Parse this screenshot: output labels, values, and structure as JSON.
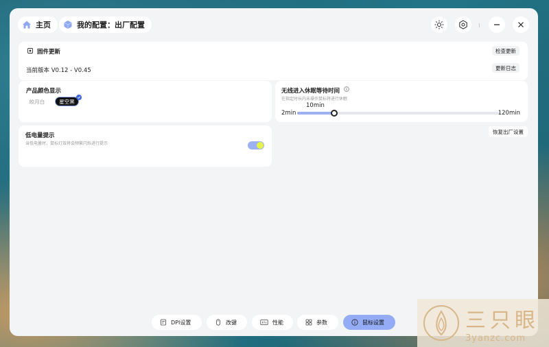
{
  "header": {
    "home_label": "主页",
    "config_label": "我的配置：出厂配置"
  },
  "firmware": {
    "title": "固件更新",
    "check_update": "检查更新",
    "version": "当前版本 V0.12 - V0.45",
    "changelog": "更新日志"
  },
  "product_color": {
    "title": "产品颜色显示",
    "options": [
      "皎月白",
      "星空黑"
    ],
    "selected": "星空黑"
  },
  "low_battery": {
    "title": "低电量提示",
    "desc": "当低电量时，鼠标灯效将会频繁闪烁进行提示",
    "enabled": true
  },
  "sleep": {
    "title": "无线进入休眠等待时间",
    "desc": "在指定时长内未操作鼠标将进行休眠",
    "min_label": "2min",
    "max_label": "120min",
    "value_label": "10min",
    "value": 10,
    "min": 2,
    "max": 120
  },
  "reset_button": "恢复出厂设置",
  "bottom_nav": {
    "dpi": "DPI设置",
    "remap": "改键",
    "perf": "性能",
    "params": "参数",
    "mouse": "鼠标设置"
  },
  "watermark": {
    "brand": "三只眼",
    "site": "3yanzc.com"
  }
}
